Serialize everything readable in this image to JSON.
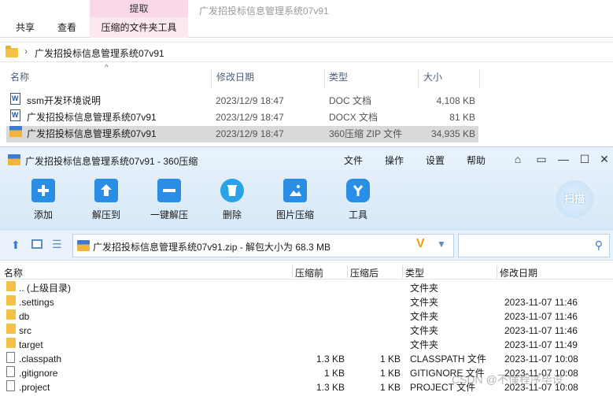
{
  "explorer": {
    "window_title": "广发招投标信息管理系统07v91",
    "context_header": "提取",
    "tabs": [
      "共享",
      "查看",
      "压缩的文件夹工具"
    ],
    "breadcrumb": "广发招投标信息管理系统07v91",
    "columns": [
      "名称",
      "修改日期",
      "类型",
      "大小"
    ],
    "files": [
      {
        "name": "ssm开发环境说明",
        "date": "2023/12/9 18:47",
        "type": "DOC 文档",
        "size": "4,108 KB",
        "icon": "word-doc-icon"
      },
      {
        "name": "广发招投标信息管理系统07v91",
        "date": "2023/12/9 18:47",
        "type": "DOCX 文档",
        "size": "81 KB",
        "icon": "word-doc-icon"
      },
      {
        "name": "广发招投标信息管理系统07v91",
        "date": "2023/12/9 18:47",
        "type": "360压缩 ZIP 文件",
        "size": "34,935 KB",
        "icon": "zip-archive-icon"
      }
    ]
  },
  "zip_window": {
    "title": "广发招投标信息管理系统07v91 - 360压缩",
    "menu": [
      "文件",
      "操作",
      "设置",
      "帮助"
    ],
    "toolbar": [
      {
        "label": "添加",
        "icon": "add-icon",
        "color": "#2a8ee6"
      },
      {
        "label": "解压到",
        "icon": "extract-to-icon",
        "color": "#2a8ee6"
      },
      {
        "label": "一键解压",
        "icon": "one-click-extract-icon",
        "color": "#2a8ee6"
      },
      {
        "label": "删除",
        "icon": "delete-icon",
        "color": "#29a3e8"
      },
      {
        "label": "图片压缩",
        "icon": "image-compress-icon",
        "color": "#2a8ee6"
      },
      {
        "label": "工具",
        "icon": "tools-icon",
        "color": "#2a8ee6"
      }
    ],
    "scan_label": "扫描",
    "path_text": "广发招投标信息管理系统07v91.zip - 解包大小为 68.3 MB",
    "columns": [
      "名称",
      "压缩前",
      "压缩后",
      "类型",
      "修改日期"
    ],
    "rows": [
      {
        "name": ".. (上级目录)",
        "before": "",
        "after": "",
        "type": "文件夹",
        "date": "",
        "kind": "folder"
      },
      {
        "name": ".settings",
        "before": "",
        "after": "",
        "type": "文件夹",
        "date": "2023-11-07 11:46",
        "kind": "folder"
      },
      {
        "name": "db",
        "before": "",
        "after": "",
        "type": "文件夹",
        "date": "2023-11-07 11:46",
        "kind": "folder"
      },
      {
        "name": "src",
        "before": "",
        "after": "",
        "type": "文件夹",
        "date": "2023-11-07 11:46",
        "kind": "folder"
      },
      {
        "name": "target",
        "before": "",
        "after": "",
        "type": "文件夹",
        "date": "2023-11-07 11:49",
        "kind": "folder"
      },
      {
        "name": ".classpath",
        "before": "1.3 KB",
        "after": "1 KB",
        "type": "CLASSPATH 文件",
        "date": "2023-11-07 10:08",
        "kind": "file"
      },
      {
        "name": ".gitignore",
        "before": "1 KB",
        "after": "1 KB",
        "type": "GITIGNORE 文件",
        "date": "2023-11-07 10:08",
        "kind": "file"
      },
      {
        "name": ".project",
        "before": "1.3 KB",
        "after": "1 KB",
        "type": "PROJECT 文件",
        "date": "2023-11-07 10:08",
        "kind": "file"
      }
    ],
    "watermark": "CSDN @不懂程序毕设"
  }
}
